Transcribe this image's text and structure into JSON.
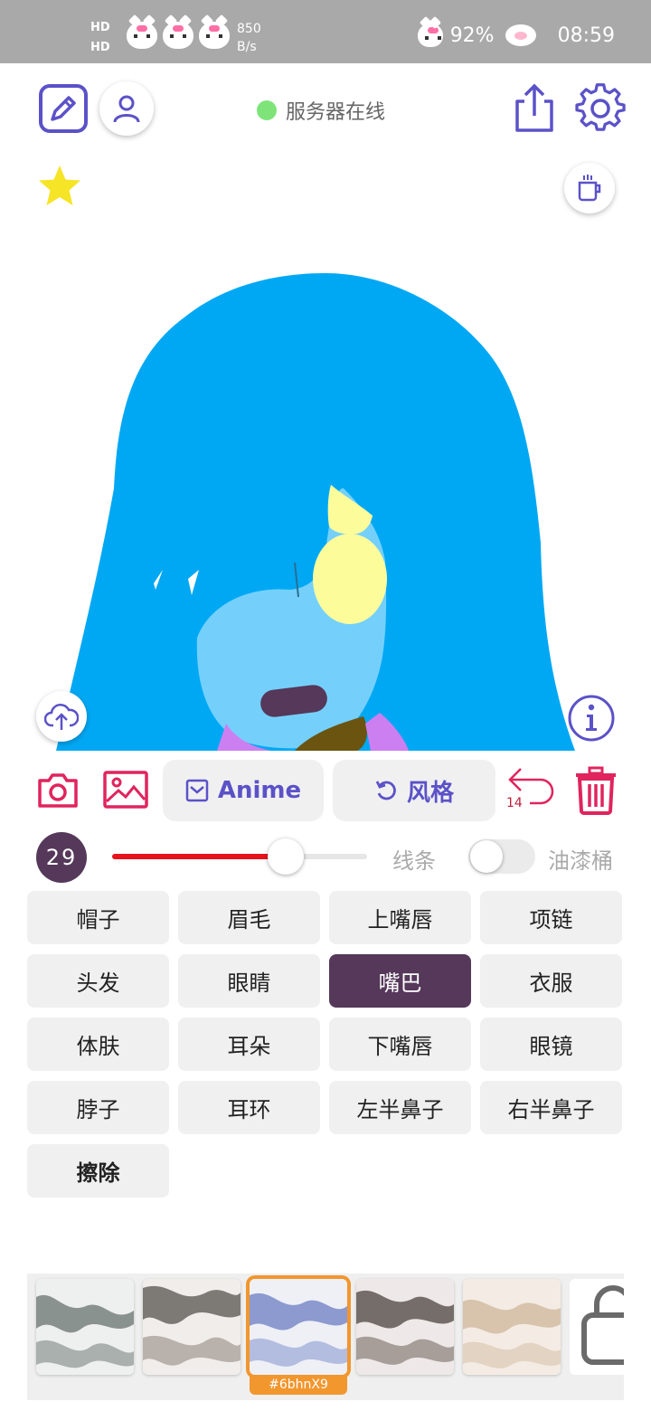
{
  "status_bar": {
    "hd1": "HD",
    "hd2": "HD",
    "speed_value": "850",
    "speed_unit": "B/s",
    "battery": "92%",
    "time": "08:59"
  },
  "header": {
    "server_status": "服务器在线",
    "server_status_color": "#7ee47a"
  },
  "actions": {
    "anime_label": "Anime",
    "style_label": "风格",
    "undo_count": "14"
  },
  "brush": {
    "size": "29",
    "slider_fraction": 0.68,
    "line_label": "线条",
    "bucket_label": "油漆桶",
    "bucket_enabled": false
  },
  "parts": [
    {
      "label": "帽子"
    },
    {
      "label": "眉毛"
    },
    {
      "label": "上嘴唇"
    },
    {
      "label": "项链"
    },
    {
      "label": "头发"
    },
    {
      "label": "眼睛"
    },
    {
      "label": "嘴巴",
      "active": true
    },
    {
      "label": "衣服"
    },
    {
      "label": "体肤"
    },
    {
      "label": "耳朵"
    },
    {
      "label": "下嘴唇"
    },
    {
      "label": "眼镜"
    },
    {
      "label": "脖子"
    },
    {
      "label": "耳环"
    },
    {
      "label": "左半鼻子"
    },
    {
      "label": "右半鼻子"
    },
    {
      "label": "擦除"
    }
  ],
  "styles": {
    "selected_caption": "#6bhnX9"
  },
  "colors": {
    "accent": "#5b52c8",
    "danger": "#e0245e",
    "active_part": "#55385a",
    "hair": "#00a8f4",
    "skin": "#74d0fb"
  }
}
